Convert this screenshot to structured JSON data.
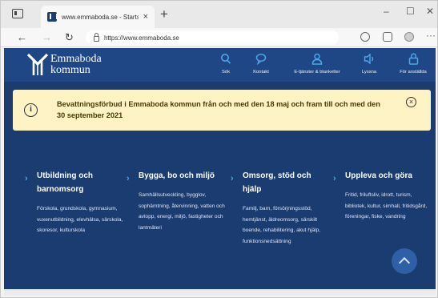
{
  "browser": {
    "tab_title": "www.emmaboda.se - Startsida",
    "tab_close": "×",
    "new_tab": "+",
    "url": "https://www.emmaboda.se",
    "back": "←",
    "forward": "→",
    "reload": "↻",
    "more": "···",
    "minimize": "–",
    "maximize": "☐",
    "close": "✕"
  },
  "site": {
    "logo_line1": "Emmaboda",
    "logo_line2": "kommun",
    "nav": [
      {
        "label": "Sök",
        "icon": "search-icon"
      },
      {
        "label": "Kontakt",
        "icon": "chat-icon"
      },
      {
        "label": "E-tjänster & blanketter",
        "icon": "person-icon"
      },
      {
        "label": "Lyssna",
        "icon": "speaker-icon"
      },
      {
        "label": "För anställda",
        "icon": "lock-icon"
      }
    ],
    "alert": {
      "text": "Bevattningsförbud i Emmaboda kommun från och med den 18 maj och fram till och med den 30 september 2021",
      "icon_glyph": "i",
      "close_glyph": "×"
    },
    "categories": [
      {
        "title": "Utbildning och barnomsorg",
        "links": "Förskola, grundskola, gymnasium, vuxenutbildning, elevhälsa, särskola, skoresor, kulturskola"
      },
      {
        "title": "Bygga, bo och miljö",
        "links": "Samhällsutveckling, bygglov, sophämtning, återvinning, vatten och avlopp, energi, miljö, fastigheter och lantmäteri"
      },
      {
        "title": "Omsorg, stöd och hjälp",
        "links": "Familj, barn, försörjningsstöd, hemtjänst, äldreomsorg, särskilt boende, rehabilitering, akut hjälp, funktionsnedsättning"
      },
      {
        "title": "Uppleva och göra",
        "links": "Fritid, friluftsliv, idrott, turism, bibliotek, kultur, simhall, fritidsgård, föreningar, fiske, vandring"
      }
    ]
  },
  "colors": {
    "header_bg": "#1f4786",
    "page_bg": "#1b3c71",
    "accent": "#4aa8ea",
    "alert_bg": "#fdf3c4"
  }
}
